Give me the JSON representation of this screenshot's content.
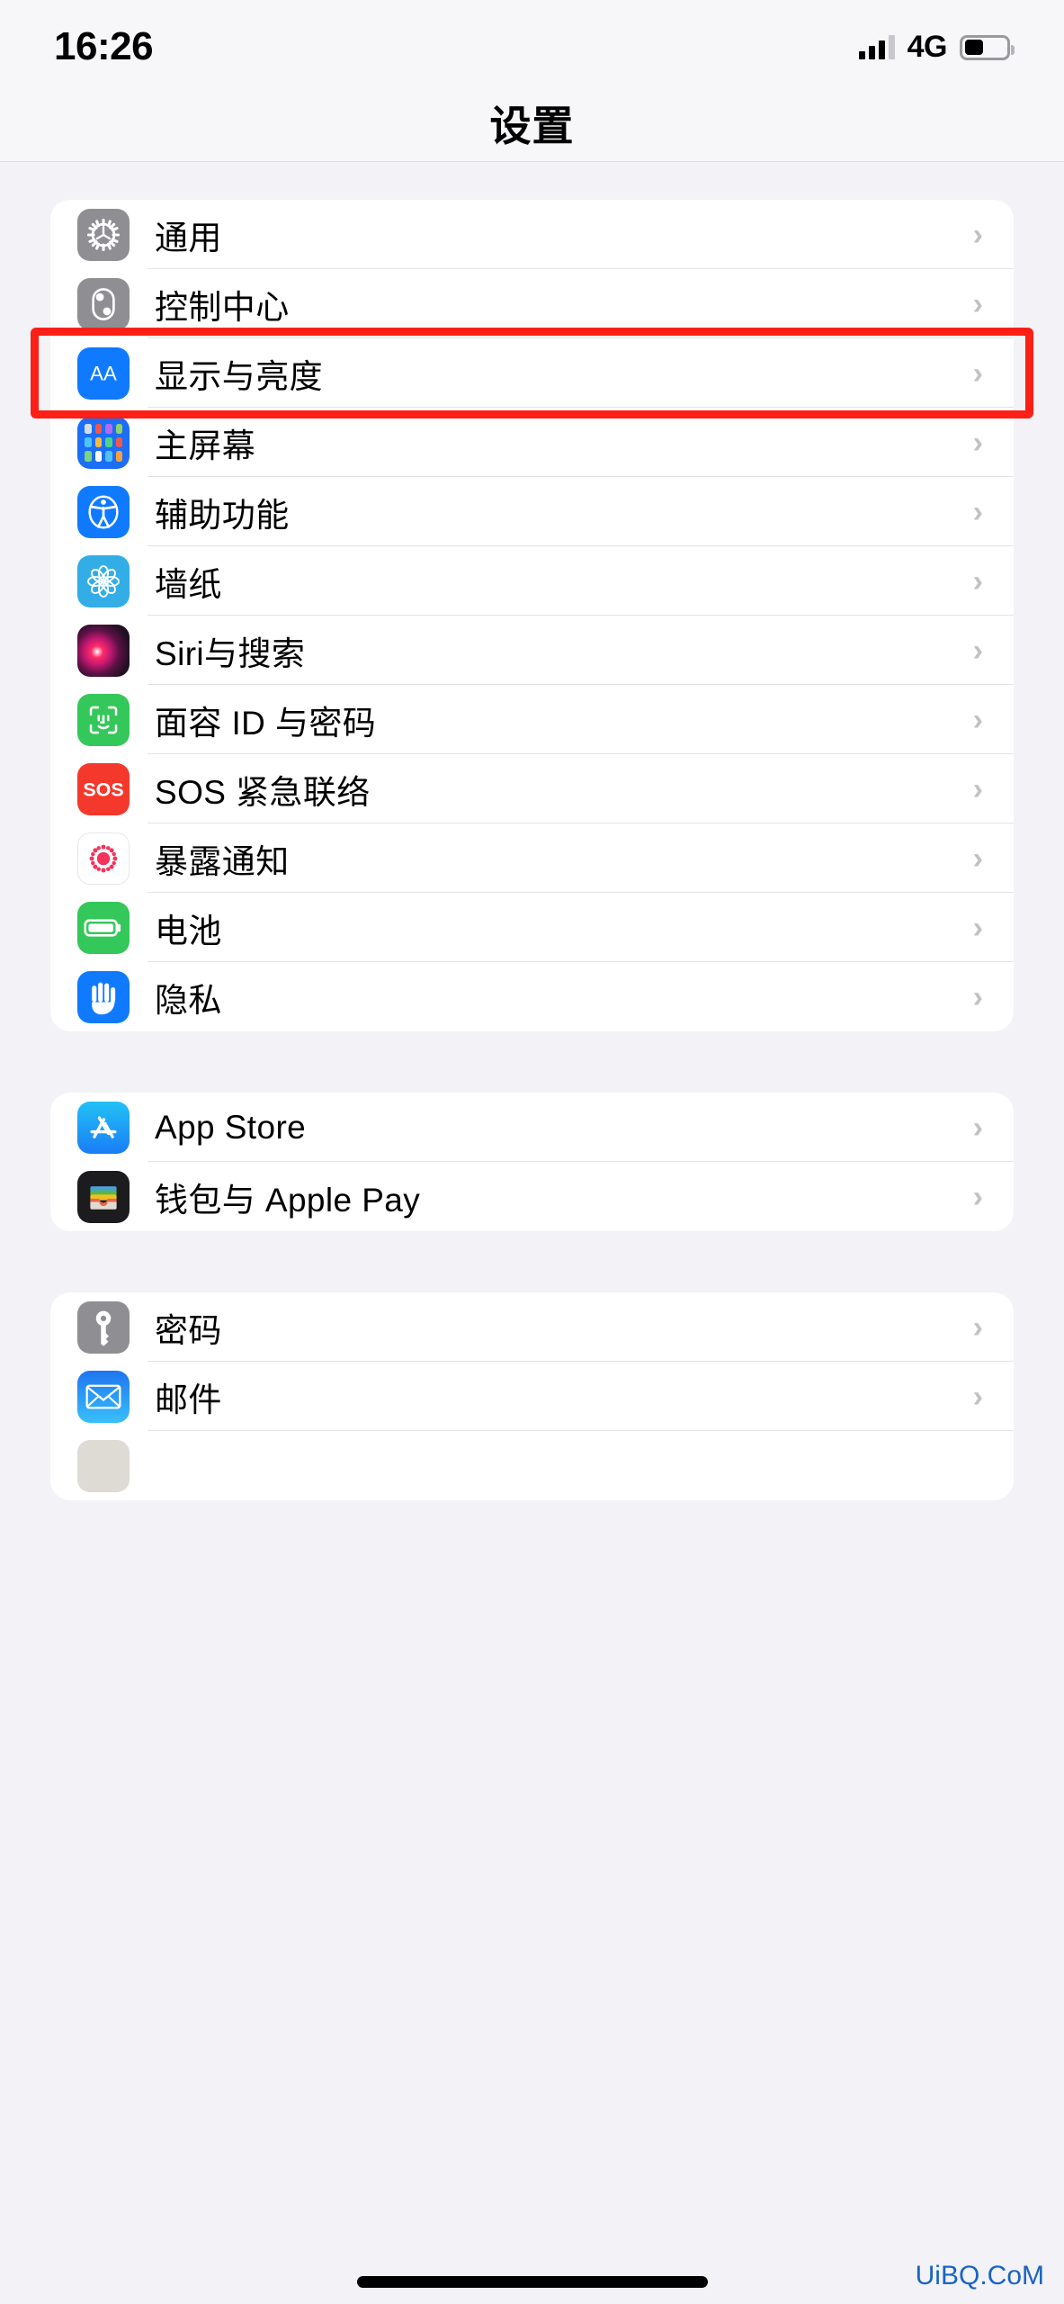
{
  "status_bar": {
    "time": "16:26",
    "network": "4G",
    "signal_icon": "cellular-bars-icon",
    "battery_icon": "battery-icon",
    "battery_level_percent": 45
  },
  "nav": {
    "title": "设置"
  },
  "colors": {
    "highlight": "#fc2016",
    "accent_blue": "#107aff",
    "page_background": "#f2f2f7",
    "card_background": "#ffffff",
    "chevron": "#c2c2c6"
  },
  "groups": [
    {
      "name": "system-group",
      "rows": [
        {
          "label": "通用",
          "icon": "gear-icon",
          "chevron": "›",
          "highlighted": false
        },
        {
          "label": "控制中心",
          "icon": "control-center-icon",
          "chevron": "›",
          "highlighted": false
        },
        {
          "label": "显示与亮度",
          "icon": "display-aa-icon",
          "chevron": "›",
          "highlighted": true
        },
        {
          "label": "主屏幕",
          "icon": "home-screen-icon",
          "chevron": "›",
          "highlighted": false
        },
        {
          "label": "辅助功能",
          "icon": "accessibility-icon",
          "chevron": "›",
          "highlighted": false
        },
        {
          "label": "墙纸",
          "icon": "wallpaper-icon",
          "chevron": "›",
          "highlighted": false
        },
        {
          "label": "Siri与搜索",
          "icon": "siri-icon",
          "chevron": "›",
          "highlighted": false
        },
        {
          "label": "面容 ID 与密码",
          "icon": "face-id-icon",
          "chevron": "›",
          "highlighted": false
        },
        {
          "label": "SOS 紧急联络",
          "icon": "sos-icon",
          "chevron": "›",
          "highlighted": false
        },
        {
          "label": "暴露通知",
          "icon": "exposure-notification-icon",
          "chevron": "›",
          "highlighted": false
        },
        {
          "label": "电池",
          "icon": "battery-settings-icon",
          "chevron": "›",
          "highlighted": false
        },
        {
          "label": "隐私",
          "icon": "privacy-hand-icon",
          "chevron": "›",
          "highlighted": false
        }
      ]
    },
    {
      "name": "store-group",
      "rows": [
        {
          "label": "App Store",
          "icon": "app-store-icon",
          "chevron": "›",
          "highlighted": false
        },
        {
          "label": "钱包与 Apple Pay",
          "icon": "wallet-icon",
          "chevron": "›",
          "highlighted": false
        }
      ]
    },
    {
      "name": "accounts-group",
      "rows": [
        {
          "label": "密码",
          "icon": "passwords-key-icon",
          "chevron": "›",
          "highlighted": false
        },
        {
          "label": "邮件",
          "icon": "mail-icon",
          "chevron": "›",
          "highlighted": false
        }
      ]
    }
  ],
  "watermark": {
    "text": "UiBQ.CoM"
  },
  "home_indicator": {
    "name": "home-indicator"
  }
}
